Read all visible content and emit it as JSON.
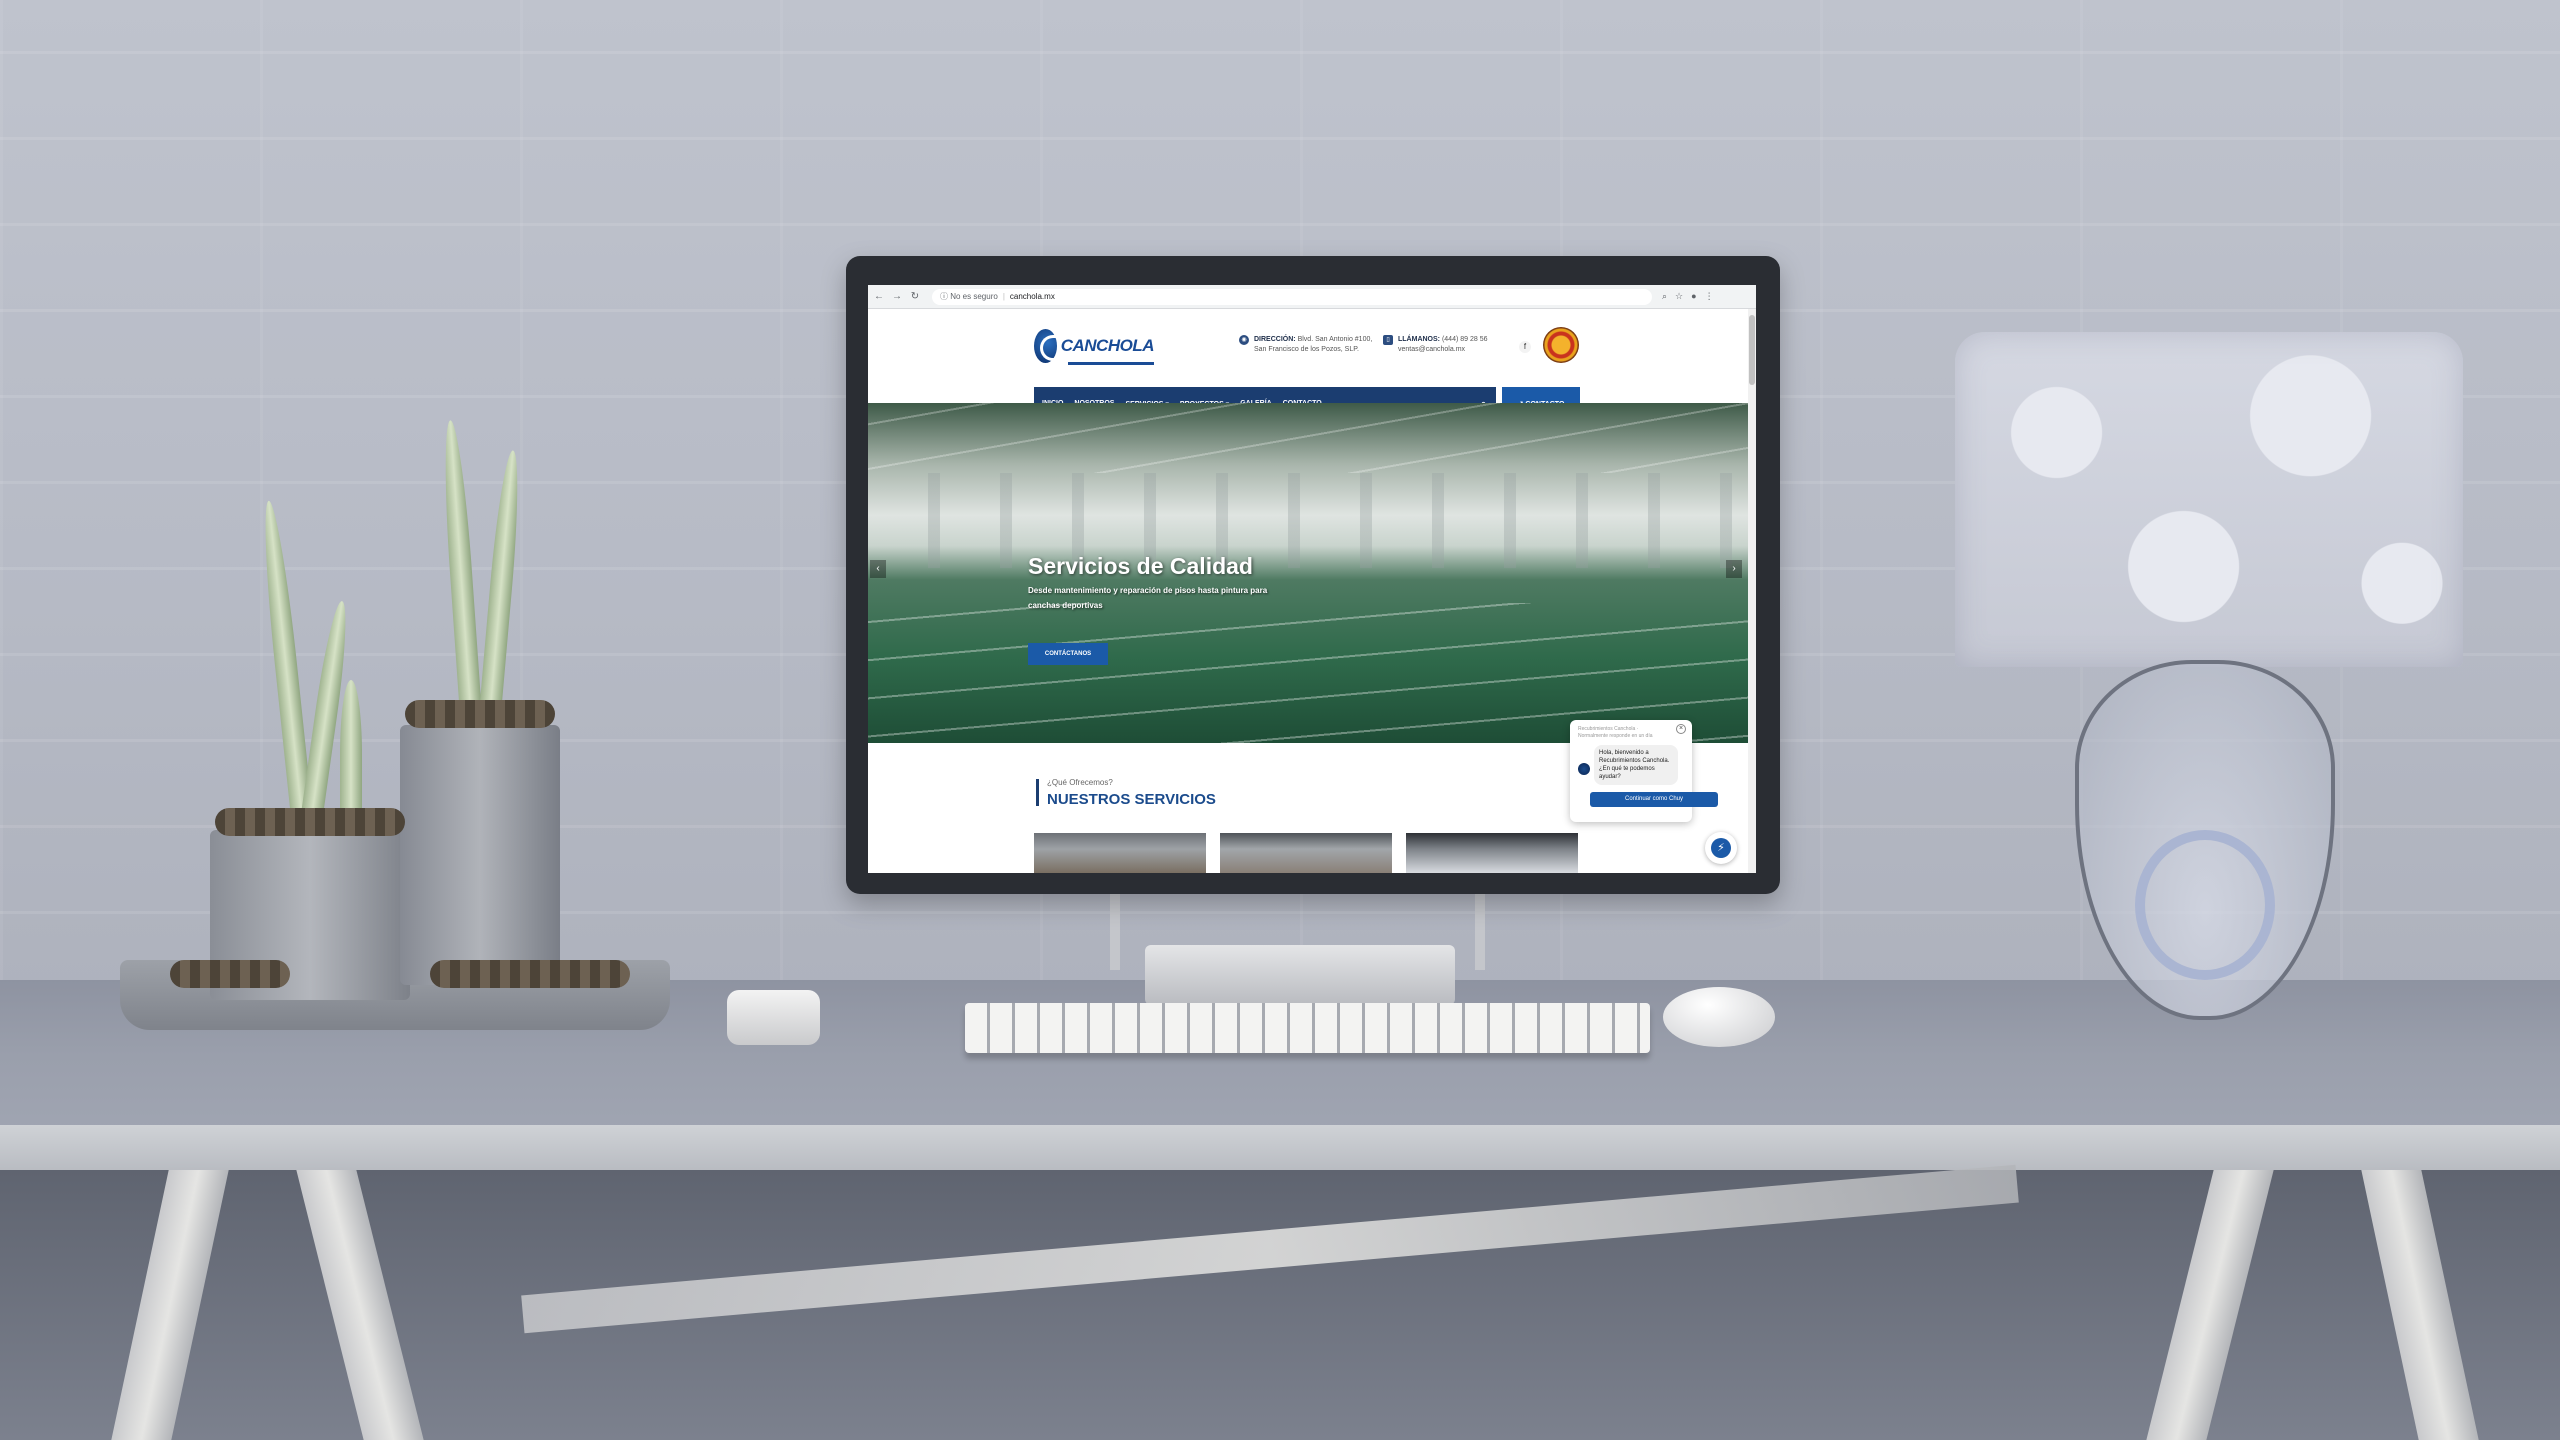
{
  "browser": {
    "security_label": "No es seguro",
    "url": "canchola.mx"
  },
  "site": {
    "logo_text": "CANCHOLA",
    "address_label": "DIRECCIÓN:",
    "address_text": "Blvd. San Antonio #100,",
    "address_text2": "San Francisco de los Pozos, SLP.",
    "phone_label": "LLÁMANOS:",
    "phone_text": "(444) 89 28 56",
    "email_text": "ventas@canchola.mx",
    "facebook_glyph": "f"
  },
  "nav": {
    "items": [
      "INICIO",
      "NOSOTROS",
      "SERVICIOS ▾",
      "PROYECTOS ▾",
      "GALERÍA",
      "CONTACTO"
    ],
    "contact_button": "↗ CONTACTO"
  },
  "hero": {
    "title": "Servicios de Calidad",
    "subtitle": "Desde mantenimiento y reparación de pisos hasta pintura para canchas deportivas",
    "button": "CONTÁCTANOS"
  },
  "services": {
    "kicker": "¿Qué Ofrecemos?",
    "title": "NUESTROS SERVICIOS"
  },
  "chat": {
    "header": "Recubrimientos Canchola · Normalmente responde en un día",
    "message": "Hola, bienvenido a Recubrimientos Canchola. ¿En qué te podemos ayudar?",
    "cta": "Continuar como Chuy"
  },
  "colors": {
    "navy": "#1b3d70",
    "accent_blue": "#1b5aa8",
    "title_blue": "#1b4b8c"
  }
}
